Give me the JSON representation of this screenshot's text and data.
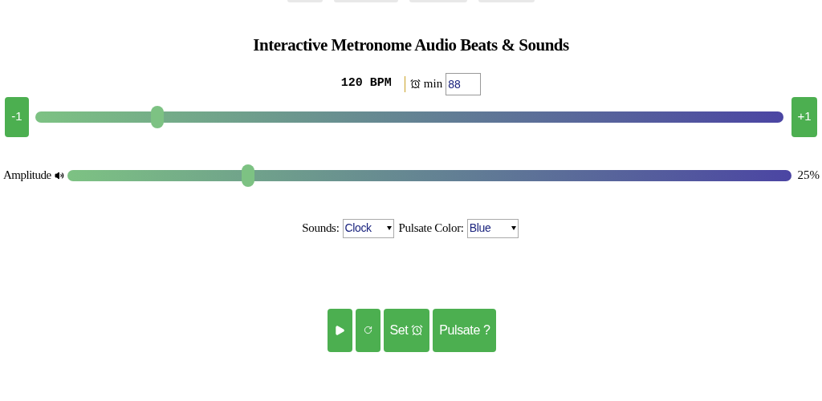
{
  "title": "Interactive Metronome Audio Beats & Sounds",
  "tempo": {
    "reading": "120 BPM",
    "timer_label": "min",
    "timer_value": "88"
  },
  "bpm_slider": {
    "decrement": "-1",
    "increment": "+1",
    "level": 0.163
  },
  "amplitude": {
    "label": "Amplitude",
    "level": 0.25,
    "reading": "25%"
  },
  "selects": [
    {
      "label": "Sounds:",
      "value": "Clock"
    },
    {
      "label": "Pulsate Color:",
      "value": "Blue"
    }
  ],
  "buttons": [
    {
      "kind": "play"
    },
    {
      "kind": "reset"
    },
    {
      "kind": "set",
      "label": "Set"
    },
    {
      "kind": "text",
      "label": "Pulsate ?"
    }
  ]
}
